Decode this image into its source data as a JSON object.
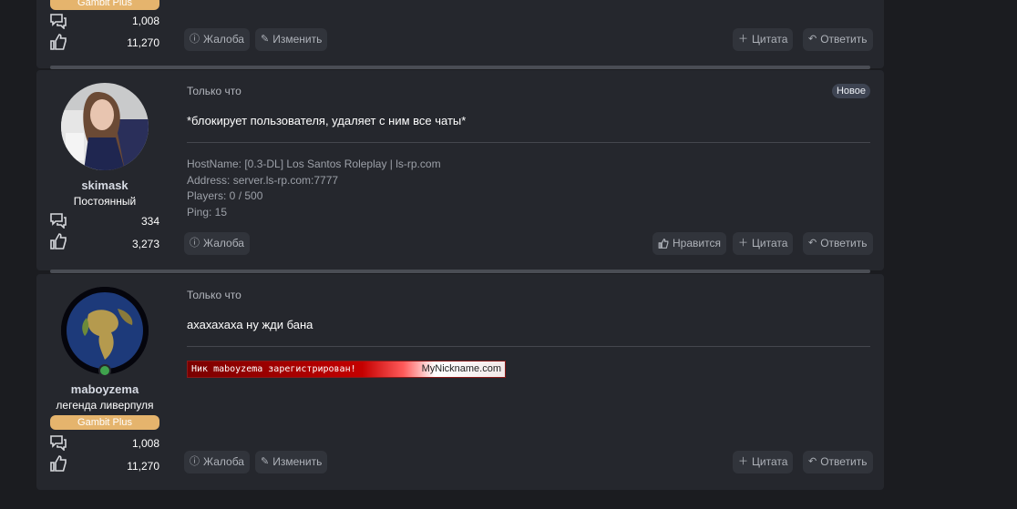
{
  "post_top": {
    "badge": "Gambit Plus",
    "messages_count": "1,008",
    "likes_count": "11,270",
    "actions": {
      "report": "Жалоба",
      "edit": "Изменить",
      "quote": "Цитата",
      "reply": "Ответить"
    }
  },
  "post1": {
    "username": "skimask",
    "user_title": "Постоянный",
    "messages_count": "334",
    "likes_count": "3,273",
    "time": "Только что",
    "new_label": "Новое",
    "message": "*блокирует пользователя, удаляет с ним все чаты*",
    "signature": [
      "HostName: [0.3-DL] Los Santos Roleplay | ls-rp.com",
      "Address: server.ls-rp.com:7777",
      "Players: 0 / 500",
      "Ping: 15"
    ],
    "actions": {
      "report": "Жалоба",
      "like": "Нравится",
      "quote": "Цитата",
      "reply": "Ответить"
    }
  },
  "post2": {
    "username": "maboyzema",
    "user_title": "легенда ливерпуля",
    "badge": "Gambit Plus",
    "messages_count": "1,008",
    "likes_count": "11,270",
    "time": "Только что",
    "message": "ахахахаха ну жди бана",
    "banner_left": "Ник maboyzema зарегистрирован!",
    "banner_right": "MyNickname.com",
    "actions": {
      "report": "Жалоба",
      "edit": "Изменить",
      "quote": "Цитата",
      "reply": "Ответить"
    }
  }
}
